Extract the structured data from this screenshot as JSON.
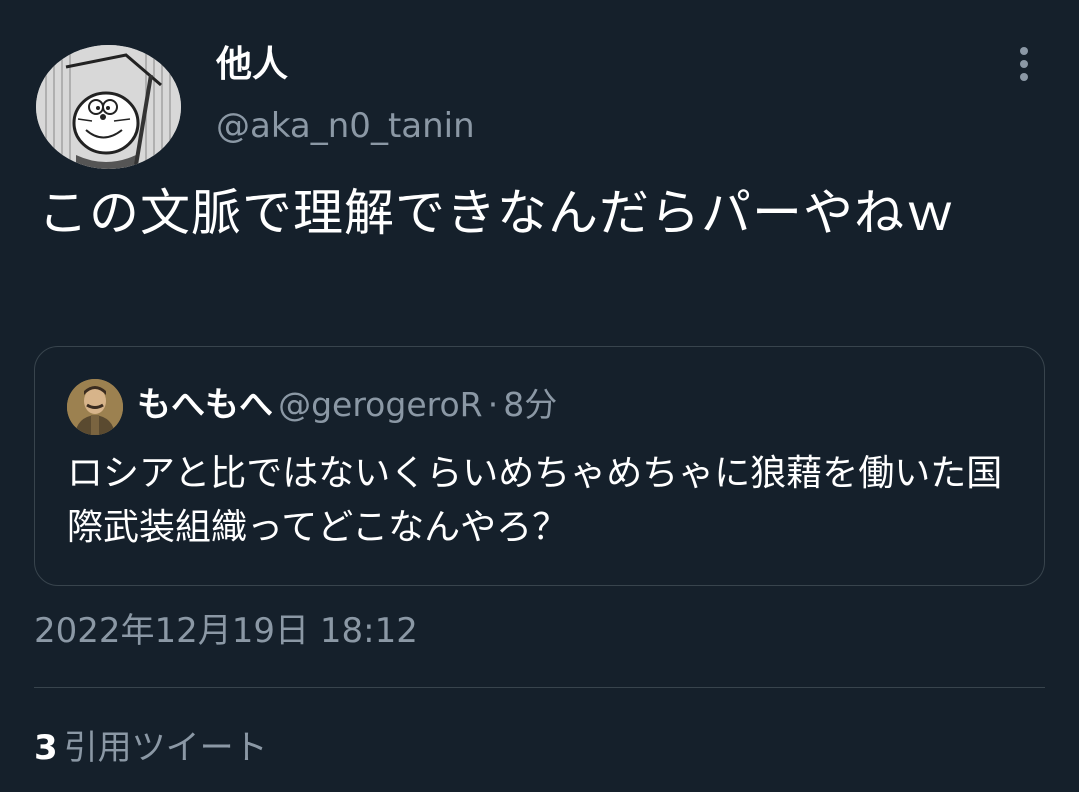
{
  "author": {
    "display_name": "他人",
    "handle": "@aka_n0_tanin",
    "avatar_icon": "manga-avatar-image"
  },
  "more_icon": "more-vertical-icon",
  "tweet": {
    "text": "この文脈で理解できなんだらパーやねｗ"
  },
  "quoted_tweet": {
    "display_name": "もへもへ",
    "handle": "@gerogeroR",
    "separator": "·",
    "time": "8分",
    "text": "ロシアと比ではないくらいめちゃめちゃに狼藉を働いた国際武装組織ってどこなんやろ？",
    "avatar_icon": "portrait-avatar-image"
  },
  "timestamp": "2022年12月19日 18:12",
  "stats": {
    "quote_count": "3",
    "quote_label": "引用ツイート"
  },
  "colors": {
    "background": "#15202b",
    "secondary_text": "#8b98a5",
    "border": "#38444d",
    "primary_text": "#ffffff"
  }
}
